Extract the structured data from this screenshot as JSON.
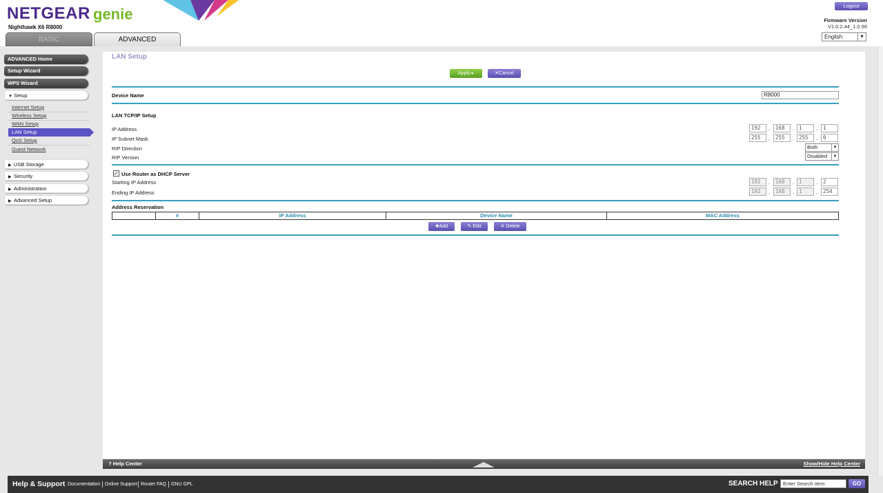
{
  "header": {
    "brand": "NETGEAR",
    "genie": "genie",
    "model": "Nighthawk X6 R8000",
    "logout_label": "Logout",
    "firmware_label": "Firmware Version",
    "firmware_value": "V1.0.2.44_1.0.96",
    "language": "English",
    "tabs": {
      "basic": "BASIC",
      "advanced": "ADVANCED"
    }
  },
  "sidebar": {
    "buttons": [
      "ADVANCED Home",
      "Setup Wizard",
      "WPS Wizard"
    ],
    "setup_menu": "Setup",
    "setup_items": [
      "Internet Setup",
      "Wireless Setup",
      "WAN Setup",
      "LAN Setup",
      "QoS Setup",
      "Guest Network"
    ],
    "other_menus": [
      "USB Storage",
      "Security",
      "Administration",
      "Advanced Setup"
    ]
  },
  "page": {
    "title": "LAN Setup",
    "apply_label": "Apply ▸",
    "cancel_label": "Cancel",
    "device_name_label": "Device Name",
    "device_name_value": "R8000",
    "lan_tcpip_heading": "LAN TCP/IP Setup",
    "ip_address_label": "IP Address",
    "ip_address": [
      "192",
      "168",
      "1",
      "1"
    ],
    "subnet_label": "IP Subnet Mask",
    "subnet": [
      "255",
      "255",
      "255",
      "0"
    ],
    "rip_direction_label": "RIP Direction",
    "rip_direction": "Both",
    "rip_version_label": "RIP Version",
    "rip_version": "Disabled",
    "dhcp_checkbox_label": "Use Router as DHCP Server",
    "dhcp_checked": true,
    "starting_ip_label": "Starting IP Address",
    "starting_ip": [
      "192",
      "168",
      "1",
      "2"
    ],
    "ending_ip_label": "Ending IP Address",
    "ending_ip": [
      "192",
      "168",
      "1",
      "254"
    ],
    "reservation_heading": "Address Reservation",
    "table_headers": [
      "",
      "#",
      "IP Address",
      "Device Name",
      "MAC Address"
    ],
    "add_label": "Add",
    "edit_label": "Edit",
    "delete_label": "Delete"
  },
  "help": {
    "help_center": "Help Center",
    "toggle": "Show/Hide Help Center"
  },
  "footer": {
    "title": "Help & Support",
    "links": [
      "Documentation",
      "Online Support",
      "Router FAQ",
      "GNU GPL"
    ],
    "search_label": "SEARCH HELP",
    "search_placeholder": "Enter Search Item",
    "go_label": "GO"
  }
}
